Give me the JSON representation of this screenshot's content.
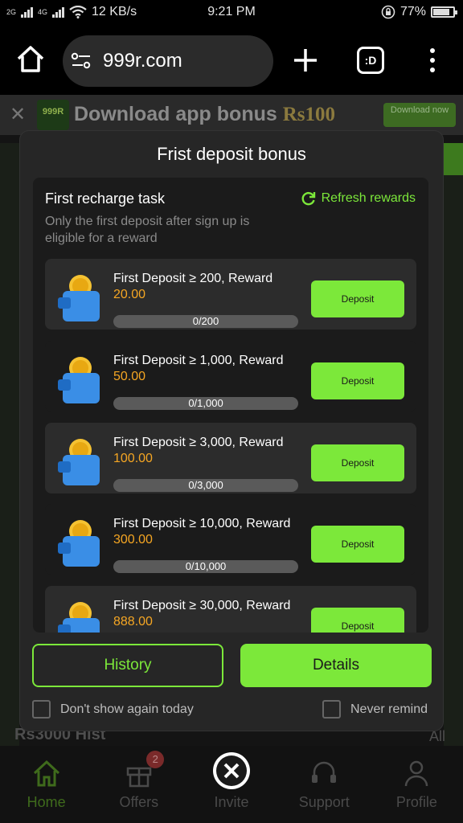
{
  "status_bar": {
    "signal_1": "2G",
    "signal_2": "4G",
    "speed": "12 KB/s",
    "time": "9:21 PM",
    "battery": "77%"
  },
  "browser": {
    "url": "999r.com",
    "tabs_label": ":D"
  },
  "banner": {
    "logo_text": "999R",
    "text": "Download app bonus ",
    "amount": "Rs100",
    "button": "Download now"
  },
  "background": {
    "history_fragment": "Rs3000 Hist",
    "all_fragment": "All"
  },
  "modal": {
    "title": "Frist deposit bonus",
    "task_title": "First recharge task",
    "refresh_label": "Refresh rewards",
    "description": "Only the first deposit after sign up is eligible for a reward",
    "deposit_label": "Deposit",
    "tasks": [
      {
        "title": "First Deposit ≥ 200, Reward",
        "reward": "20.00",
        "progress": "0/200",
        "progress_fraction": 0
      },
      {
        "title": "First Deposit ≥ 1,000, Reward",
        "reward": "50.00",
        "progress": "0/1,000",
        "progress_fraction": 0
      },
      {
        "title": "First Deposit ≥ 3,000, Reward",
        "reward": "100.00",
        "progress": "0/3,000",
        "progress_fraction": 0
      },
      {
        "title": "First Deposit ≥ 10,000, Reward",
        "reward": "300.00",
        "progress": "0/10,000",
        "progress_fraction": 0
      },
      {
        "title": "First Deposit ≥ 30,000, Reward",
        "reward": "888.00",
        "progress": "",
        "progress_fraction": 0
      }
    ],
    "history_button": "History",
    "details_button": "Details",
    "dont_show_label": "Don't show again today",
    "never_remind_label": "Never remind"
  },
  "bottom_nav": {
    "items": [
      {
        "label": "Home",
        "icon": "home-icon",
        "active": true
      },
      {
        "label": "Offers",
        "icon": "gift-icon",
        "badge": "2"
      },
      {
        "label": "Invite",
        "icon": "close-circle-icon"
      },
      {
        "label": "Support",
        "icon": "headset-icon"
      },
      {
        "label": "Profile",
        "icon": "person-icon"
      }
    ]
  },
  "colors": {
    "accent": "#7ce83a",
    "reward": "#f5a623",
    "modal_bg": "#262626"
  }
}
